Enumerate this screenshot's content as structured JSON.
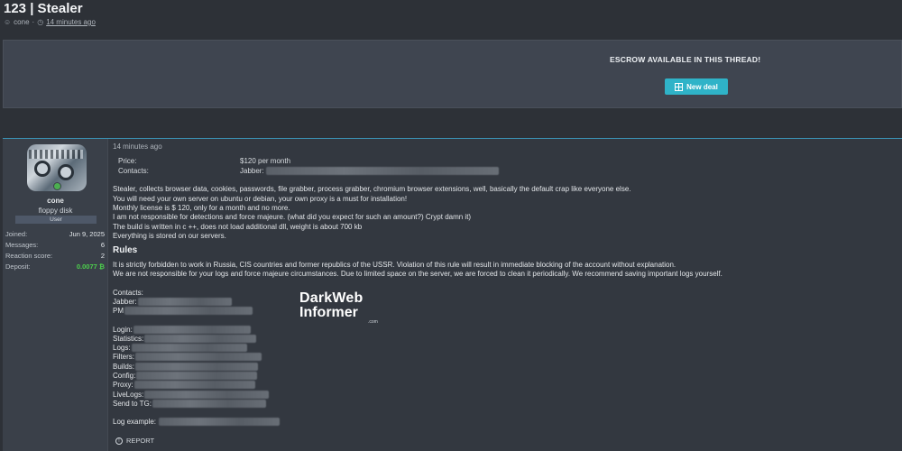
{
  "thread": {
    "title": "123 | Stealer",
    "author": "cone",
    "time_ago": "14 minutes ago"
  },
  "escrow": {
    "text": "ESCROW AVAILABLE IN THIS THREAD!",
    "button_label": "New deal"
  },
  "user": {
    "name": "cone",
    "title": "floppy disk",
    "badge": "User",
    "stats": [
      {
        "label": "Joined:",
        "value": "Jun 9, 2025"
      },
      {
        "label": "Messages:",
        "value": "6"
      },
      {
        "label": "Reaction score:",
        "value": "2"
      },
      {
        "label": "Deposit:",
        "value": "0.0077 ₿"
      }
    ]
  },
  "post": {
    "time_ago": "14 minutes ago",
    "price_label": "Price:",
    "price_value": "$120 per month",
    "contacts_label": "Contacts:",
    "contacts_value": "Jabber:",
    "paragraphs": [
      "Stealer, collects browser data, cookies, passwords, file grabber, process grabber, chromium browser extensions, well, basically the default crap like everyone else.",
      "You will need your own server on ubuntu or debian, your own proxy is a must for installation!",
      "Monthly license is $ 120, only for a month and no more.",
      "I am not responsible for detections and force majeure. (what did you expect for such an amount?) Crypt damn it)",
      "The build is written in c ++, does not load additional dll, weight is about 700 kb",
      "Everything is stored on our servers."
    ],
    "rules_heading": "Rules",
    "rules": [
      "It is strictly forbidden to work in Russia, CIS countries and former republics of the USSR. Violation of this rule will result in immediate blocking of the account without explanation.",
      "We are not responsible for your logs and force majeure circumstances. Due to limited space on the server, we are forced to clean it periodically. We recommend saving important logs yourself."
    ],
    "contacts_heading": "Contacts:",
    "contact_lines": [
      "Jabber:",
      "PM"
    ],
    "panel_lines": [
      "Login:",
      "Statistics:",
      "Logs:",
      "Filters:",
      "Builds:",
      "Config:",
      "Proxy:",
      "LiveLogs:",
      "Send to TG:"
    ],
    "log_example": "Log example:",
    "report_label": "REPORT"
  },
  "watermark": {
    "line1": "DarkWeb",
    "line2": "Informer",
    "line3": ".com"
  },
  "colors": {
    "accent": "#2fb3c8",
    "deposit": "#4cd04c",
    "background": "#2d3137"
  }
}
